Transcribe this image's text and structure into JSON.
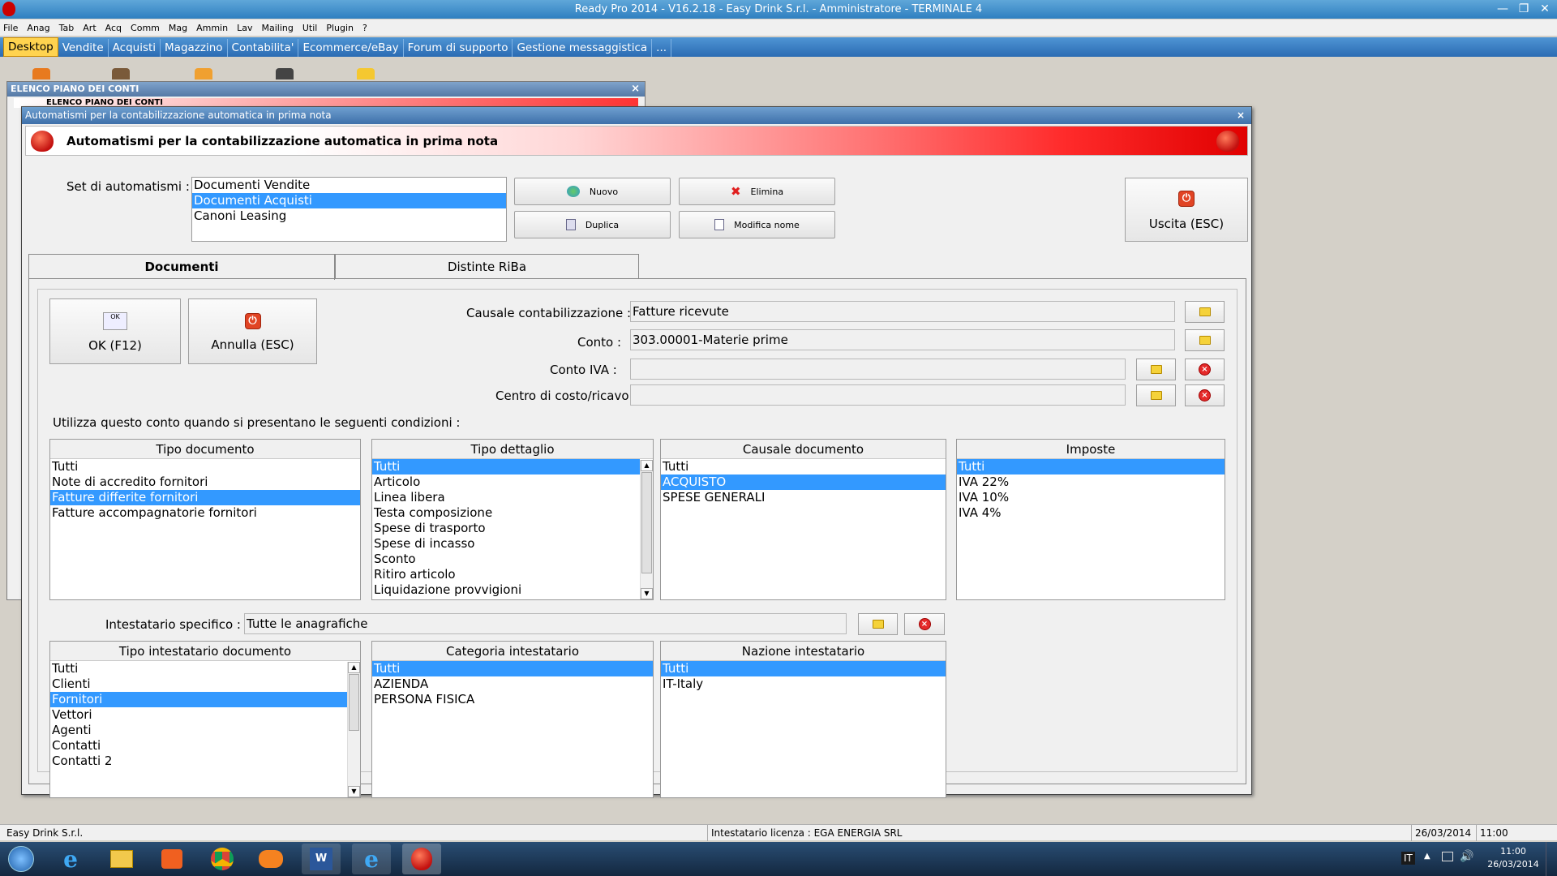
{
  "window": {
    "title": "Ready Pro 2014 - V16.2.18 - Easy Drink S.r.l. - Amministratore - TERMINALE 4"
  },
  "menubar": [
    "File",
    "Anag",
    "Tab",
    "Art",
    "Acq",
    "Comm",
    "Mag",
    "Ammin",
    "Lav",
    "Mailing",
    "Util",
    "Plugin",
    "?"
  ],
  "tabs": [
    "Desktop",
    "Vendite",
    "Acquisti",
    "Magazzino",
    "Contabilita'",
    "Ecommerce/eBay",
    "Forum di supporto",
    "Gestione messaggistica",
    "..."
  ],
  "bg_window": {
    "title": "ELENCO PIANO DEI CONTI",
    "banner": "ELENCO PIANO DEI CONTI"
  },
  "dialog": {
    "title": "Automatismi per la contabilizzazione automatica in prima nota",
    "banner": "Automatismi per la contabilizzazione automatica in prima nota",
    "set_label": "Set di automatismi :",
    "sets": [
      "Documenti Vendite",
      "Documenti Acquisti",
      "Canoni Leasing"
    ],
    "buttons": {
      "nuovo": "Nuovo",
      "elimina": "Elimina",
      "duplica": "Duplica",
      "modifica": "Modifica nome",
      "uscita": "Uscita (ESC)",
      "ok": "OK (F12)",
      "annulla": "Annulla (ESC)"
    },
    "tabs": [
      "Documenti",
      "Distinte RiBa"
    ],
    "causale_label": "Causale contabilizzazione :",
    "causale_value": "Fatture ricevute",
    "conto_label": "Conto :",
    "conto_value": "303.00001-Materie prime",
    "contoiva_label": "Conto IVA :",
    "contoiva_value": "",
    "centro_label": "Centro di costo/ricavo",
    "centro_value": "",
    "conditions_label": "Utilizza questo conto quando si presentano le seguenti condizioni :",
    "tipo_documento": {
      "header": "Tipo documento",
      "items": [
        "Tutti",
        "Note di accredito fornitori",
        "Fatture differite fornitori",
        "Fatture accompagnatorie fornitori"
      ]
    },
    "tipo_dettaglio": {
      "header": "Tipo dettaglio",
      "items": [
        "Tutti",
        "Articolo",
        "Linea libera",
        "Testa composizione",
        "Spese di trasporto",
        "Spese di incasso",
        "Sconto",
        "Ritiro articolo",
        "Liquidazione provvigioni"
      ]
    },
    "causale_documento": {
      "header": "Causale documento",
      "items": [
        "Tutti",
        "ACQUISTO",
        "SPESE GENERALI"
      ]
    },
    "imposte": {
      "header": "Imposte",
      "items": [
        "Tutti",
        "IVA 22%",
        "IVA 10%",
        "IVA 4%"
      ]
    },
    "intestatario_label": "Intestatario specifico :",
    "intestatario_value": "Tutte le anagrafiche",
    "tipo_intestatario": {
      "header": "Tipo intestatario documento",
      "items": [
        "Tutti",
        "Clienti",
        "Fornitori",
        "Vettori",
        "Agenti",
        "Contatti",
        "Contatti 2"
      ]
    },
    "categoria_intestatario": {
      "header": "Categoria intestatario",
      "items": [
        "Tutti",
        "AZIENDA",
        "PERSONA FISICA"
      ]
    },
    "nazione_intestatario": {
      "header": "Nazione intestatario",
      "items": [
        "Tutti",
        "IT-Italy"
      ]
    }
  },
  "statusbar": {
    "company": "Easy Drink S.r.l.",
    "licence": "Intestatario licenza : EGA ENERGIA SRL",
    "date": "26/03/2014",
    "time": "11:00"
  },
  "taskbar": {
    "lang": "IT",
    "clock_time": "11:00",
    "clock_date": "26/03/2014"
  },
  "colors": {
    "selection": "#3399ff",
    "tab_active": "#ffd34f",
    "titlebar": "#2f7fc0"
  }
}
